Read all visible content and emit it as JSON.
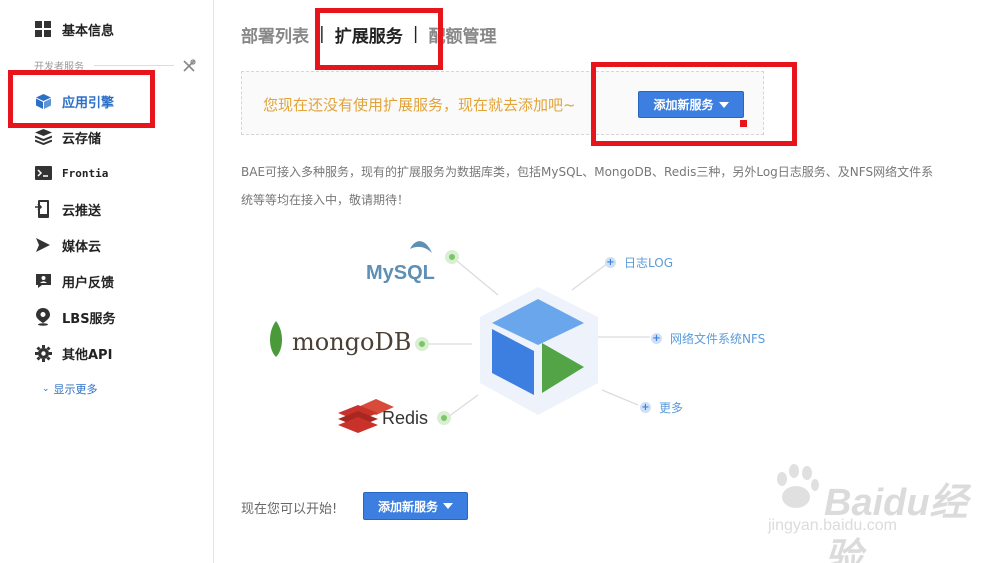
{
  "sidebar": {
    "basic_info": "基本信息",
    "section_label": "开发者服务",
    "items": [
      {
        "label": "应用引擎",
        "icon": "app-engine-icon"
      },
      {
        "label": "云存储",
        "icon": "cloud-storage-icon"
      },
      {
        "label": "Frontia",
        "icon": "terminal-icon"
      },
      {
        "label": "云推送",
        "icon": "push-icon"
      },
      {
        "label": "媒体云",
        "icon": "media-icon"
      },
      {
        "label": "用户反馈",
        "icon": "feedback-icon"
      },
      {
        "label": "LBS服务",
        "icon": "location-icon"
      },
      {
        "label": "其他API",
        "icon": "gear-icon"
      }
    ],
    "show_more": "显示更多"
  },
  "tabs": {
    "items": [
      "部署列表",
      "扩展服务",
      "配额管理"
    ],
    "separator": "|"
  },
  "notice": {
    "text": "您现在还没有使用扩展服务，现在就去添加吧~",
    "button": "添加新服务"
  },
  "description": "BAE可接入多种服务，现有的扩展服务为数据库类，包括MySQL、MongoDB、Redis三种，另外Log日志服务、及NFS网络文件系统等等均在接入中，敬请期待！",
  "diagram": {
    "databases": [
      "MySQL",
      "mongoDB",
      "Redis"
    ],
    "services": [
      "日志LOG",
      "网络文件系统NFS",
      "更多"
    ]
  },
  "footer": {
    "start_text": "现在您可以开始!",
    "button": "添加新服务"
  },
  "watermark": {
    "brand": "Baidu经验",
    "url": "jingyan.baidu.com"
  },
  "colors": {
    "accent": "#3d7fe0",
    "notice_text": "#e1a43a",
    "annotation": "#e8141b",
    "mongo_green": "#4a9a3a",
    "redis_red": "#c8322b"
  }
}
